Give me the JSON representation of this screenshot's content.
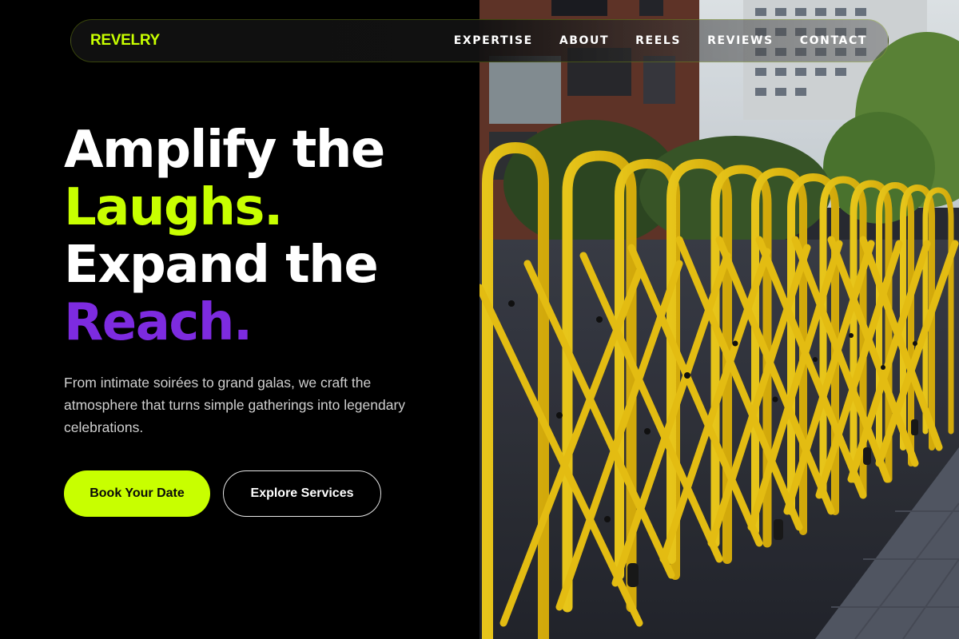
{
  "brand": {
    "name": "REVELRY",
    "accent": "#c8ff00",
    "purple": "#7d2be0"
  },
  "nav": {
    "items": [
      {
        "label": "EXPERTISE"
      },
      {
        "label": "ABOUT"
      },
      {
        "label": "REELS"
      },
      {
        "label": "REVIEWS"
      },
      {
        "label": "CONTACT"
      }
    ]
  },
  "hero": {
    "line1": "Amplify the",
    "line2": "Laughs.",
    "line3": "Expand the",
    "line4": "Reach.",
    "description": "From intimate soirées to grand galas, we craft the atmosphere that turns simple gatherings into legendary celebrations.",
    "primary_cta": "Book Your Date",
    "secondary_cta": "Explore Services"
  },
  "photo": {
    "subject": "yellow expandable street barriers"
  }
}
